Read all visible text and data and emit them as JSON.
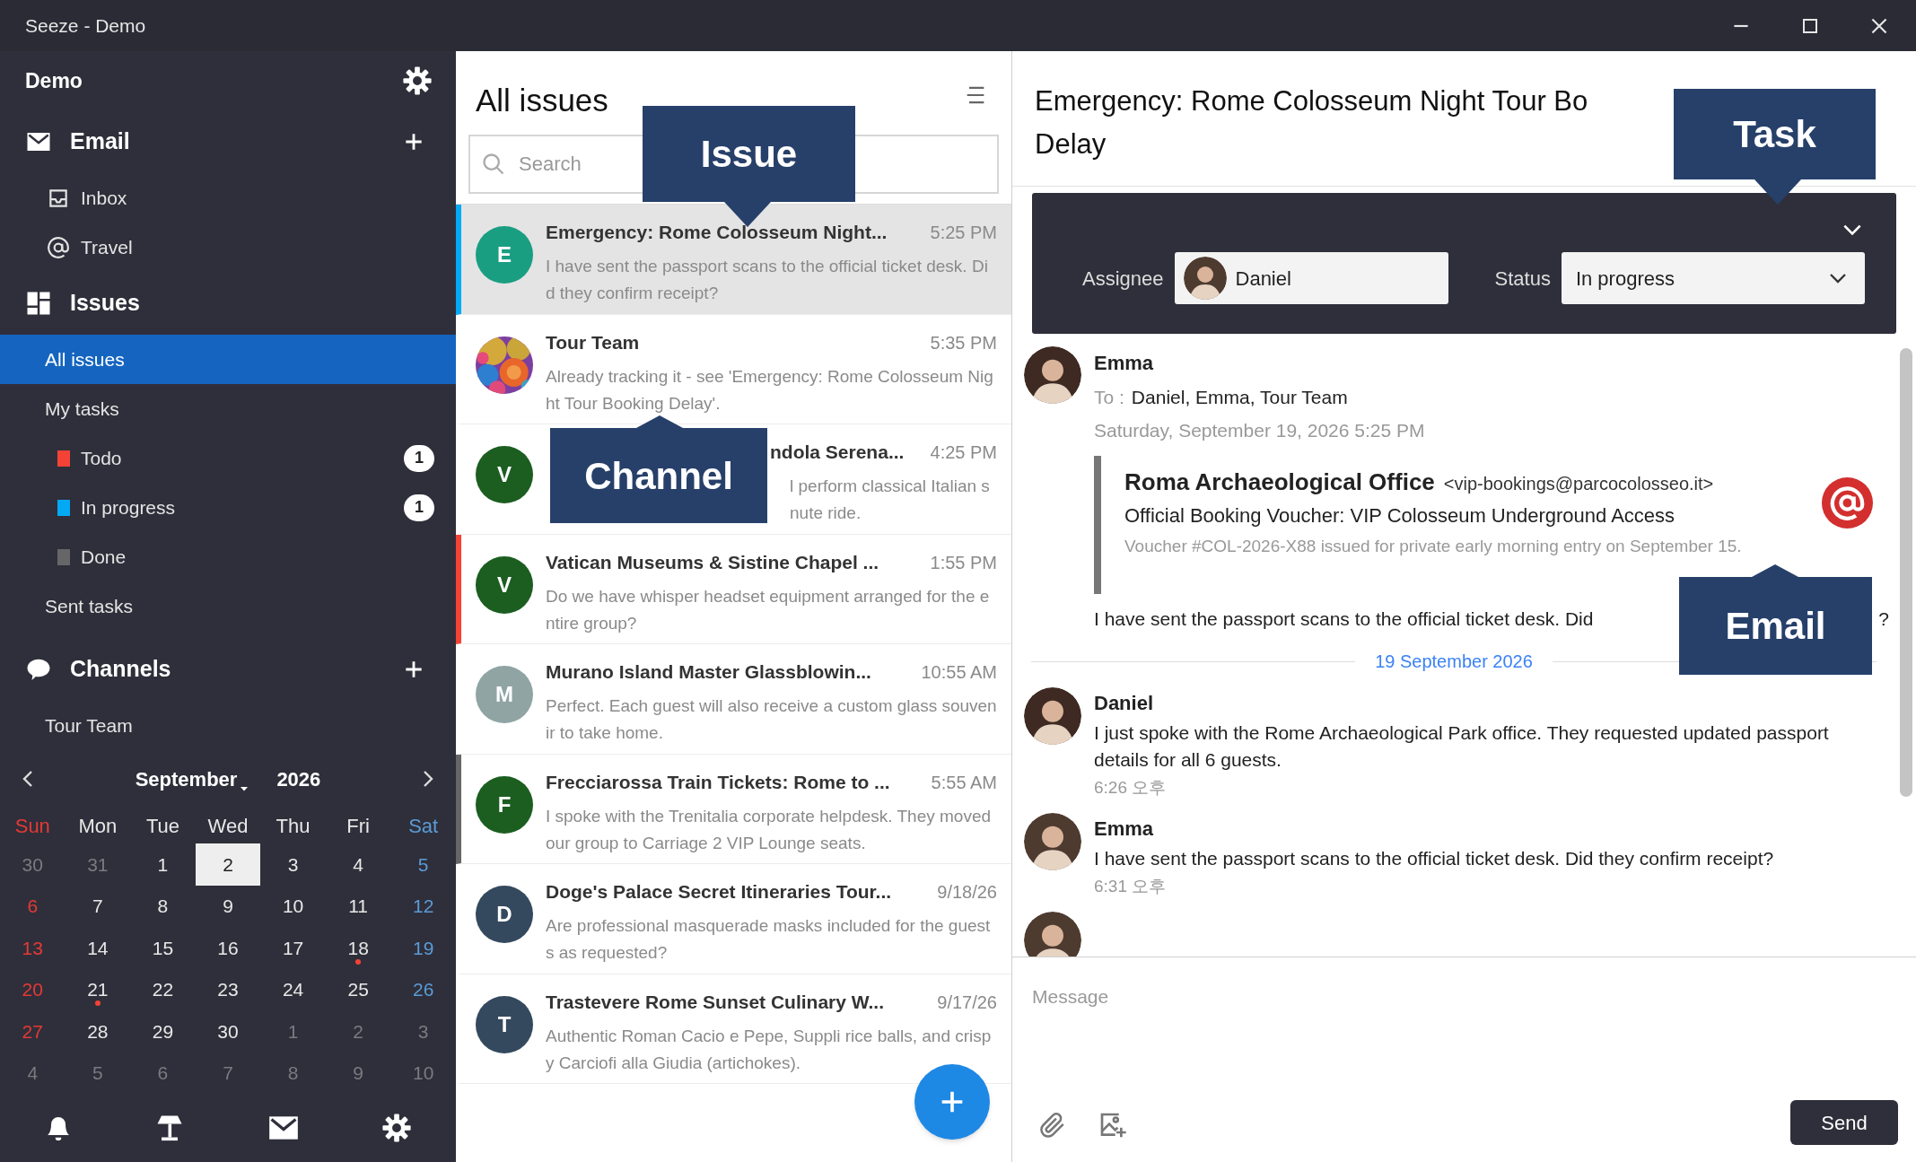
{
  "window": {
    "title": "Seeze - Demo"
  },
  "sidebar": {
    "workspace": "Demo",
    "sections": [
      {
        "kind": "email",
        "label": "Email",
        "add": true,
        "items": [
          {
            "label": "Inbox",
            "selected": false
          },
          {
            "label": "Travel",
            "selected": false
          }
        ]
      },
      {
        "kind": "issues",
        "label": "Issues",
        "items": [
          {
            "label": "All issues",
            "selected": true
          },
          {
            "label": "My tasks",
            "selected": false,
            "children": [
              {
                "label": "Todo",
                "color": "#f44336",
                "count": "1",
                "selected": false
              },
              {
                "label": "In progress",
                "color": "#03a9f4",
                "count": "1",
                "selected": false
              },
              {
                "label": "Done",
                "color": "#666666",
                "selected": false
              }
            ]
          },
          {
            "label": "Sent tasks",
            "selected": false
          }
        ]
      },
      {
        "kind": "channels",
        "label": "Channels",
        "add": true,
        "items": [
          {
            "label": "Tour Team",
            "selected": false
          }
        ]
      }
    ]
  },
  "calendar": {
    "month": "September",
    "year": "2026",
    "weekdays": [
      "Sun",
      "Mon",
      "Tue",
      "Wed",
      "Thu",
      "Fri",
      "Sat"
    ],
    "weeks": [
      [
        {
          "day": "30",
          "outside": true,
          "selected": false,
          "event": false
        },
        {
          "day": "31",
          "outside": true,
          "selected": false,
          "event": false
        },
        {
          "day": "1",
          "outside": false,
          "selected": false,
          "event": false
        },
        {
          "day": "2",
          "outside": false,
          "selected": true,
          "event": false
        },
        {
          "day": "3",
          "outside": false,
          "selected": false,
          "event": false
        },
        {
          "day": "4",
          "outside": false,
          "selected": false,
          "event": false
        },
        {
          "day": "5",
          "outside": false,
          "selected": false,
          "event": false
        }
      ],
      [
        {
          "day": "6",
          "outside": false,
          "selected": false,
          "event": false
        },
        {
          "day": "7",
          "outside": false,
          "selected": false,
          "event": false
        },
        {
          "day": "8",
          "outside": false,
          "selected": false,
          "event": false
        },
        {
          "day": "9",
          "outside": false,
          "selected": false,
          "event": false
        },
        {
          "day": "10",
          "outside": false,
          "selected": false,
          "event": false
        },
        {
          "day": "11",
          "outside": false,
          "selected": false,
          "event": false
        },
        {
          "day": "12",
          "outside": false,
          "selected": false,
          "event": false
        }
      ],
      [
        {
          "day": "13",
          "outside": false,
          "selected": false,
          "event": false
        },
        {
          "day": "14",
          "outside": false,
          "selected": false,
          "event": false
        },
        {
          "day": "15",
          "outside": false,
          "selected": false,
          "event": false
        },
        {
          "day": "16",
          "outside": false,
          "selected": false,
          "event": false
        },
        {
          "day": "17",
          "outside": false,
          "selected": false,
          "event": false
        },
        {
          "day": "18",
          "outside": false,
          "selected": false,
          "event": true
        },
        {
          "day": "19",
          "outside": false,
          "selected": false,
          "event": false
        }
      ],
      [
        {
          "day": "20",
          "outside": false,
          "selected": false,
          "event": false
        },
        {
          "day": "21",
          "outside": false,
          "selected": false,
          "event": true
        },
        {
          "day": "22",
          "outside": false,
          "selected": false,
          "event": false
        },
        {
          "day": "23",
          "outside": false,
          "selected": false,
          "event": false
        },
        {
          "day": "24",
          "outside": false,
          "selected": false,
          "event": false
        },
        {
          "day": "25",
          "outside": false,
          "selected": false,
          "event": false
        },
        {
          "day": "26",
          "outside": false,
          "selected": false,
          "event": false
        }
      ],
      [
        {
          "day": "27",
          "outside": false,
          "selected": false,
          "event": false
        },
        {
          "day": "28",
          "outside": false,
          "selected": false,
          "event": false
        },
        {
          "day": "29",
          "outside": false,
          "selected": false,
          "event": false
        },
        {
          "day": "30",
          "outside": false,
          "selected": false,
          "event": false
        },
        {
          "day": "1",
          "outside": true,
          "selected": false,
          "event": false
        },
        {
          "day": "2",
          "outside": true,
          "selected": false,
          "event": false
        },
        {
          "day": "3",
          "outside": true,
          "selected": false,
          "event": false
        }
      ],
      [
        {
          "day": "4",
          "outside": true,
          "selected": false,
          "event": false
        },
        {
          "day": "5",
          "outside": true,
          "selected": false,
          "event": false
        },
        {
          "day": "6",
          "outside": true,
          "selected": false,
          "event": false
        },
        {
          "day": "7",
          "outside": true,
          "selected": false,
          "event": false
        },
        {
          "day": "8",
          "outside": true,
          "selected": false,
          "event": false
        },
        {
          "day": "9",
          "outside": true,
          "selected": false,
          "event": false
        },
        {
          "day": "10",
          "outside": true,
          "selected": false,
          "event": false
        }
      ]
    ]
  },
  "issue_list": {
    "title": "All issues",
    "search": {
      "placeholder": "Search"
    },
    "items": [
      {
        "kind": "full",
        "title": "Emergency: Rome Colosseum Night...",
        "time": "5:25 PM",
        "preview": "I have sent the passport scans to the official ticket desk. Did they confirm receipt?",
        "avatar": {
          "kind": "letter",
          "letter": "E",
          "color": "#1a9e82"
        },
        "color": "#03a9f4",
        "selected": true
      },
      {
        "kind": "full",
        "title": "Tour Team",
        "time": "5:35 PM",
        "preview": "Already tracking it - see 'Emergency: Rome Colosseum Night Tour Booking Delay'.",
        "selected": false
      },
      {
        "kind": "covered",
        "title": "ndola Serena...",
        "time": "4:25 PM",
        "preview_lines": [
          "l perform classical Italian s",
          "nute ride."
        ],
        "avatar": {
          "kind": "letter",
          "letter": "V",
          "color": "#1b5e20"
        },
        "selected": false
      },
      {
        "kind": "full",
        "title": "Vatican Museums & Sistine Chapel ...",
        "time": "1:55 PM",
        "preview": "Do we have whisper headset equipment arranged for the entire group?",
        "avatar": {
          "kind": "letter",
          "letter": "V",
          "color": "#1b5e20"
        },
        "color": "#f44336",
        "selected": false
      },
      {
        "kind": "full",
        "title": "Murano Island Master Glassblowin...",
        "time": "10:55 AM",
        "preview": "Perfect. Each guest will also receive a custom glass souvenir to take home.",
        "avatar": {
          "kind": "letter",
          "letter": "M",
          "color": "#90a4a4"
        },
        "selected": false
      },
      {
        "kind": "full",
        "title": "Frecciarossa Train Tickets: Rome to ...",
        "time": "5:55 AM",
        "preview": "I spoke with the Trenitalia corporate helpdesk. They moved our group to Carriage 2 VIP Lounge seats.",
        "avatar": {
          "kind": "letter",
          "letter": "F",
          "color": "#1b5e20"
        },
        "color": "#666666",
        "selected": false
      },
      {
        "kind": "full",
        "title": "Doge's Palace Secret Itineraries Tour...",
        "time": "9/18/26",
        "preview": "Are professional masquerade masks included for the guests as requested?",
        "avatar": {
          "kind": "letter",
          "letter": "D",
          "color": "#34495e"
        },
        "selected": false
      },
      {
        "kind": "full",
        "title": "Trastevere Rome Sunset Culinary W...",
        "time": "9/17/26",
        "preview": "Authentic Roman Cacio e Pepe, Suppli rice balls, and crispy Carciofi alla Giudia (artichokes).",
        "avatar": {
          "kind": "letter",
          "letter": "T",
          "color": "#34495e"
        },
        "selected": false
      }
    ]
  },
  "detail": {
    "title_lines": [
      "Emergency: Rome Colosseum Night Tour Bo",
      "Delay"
    ],
    "task": {
      "assignee_label": "Assignee",
      "assignee": "Daniel",
      "status_label": "Status",
      "status": "In progress"
    },
    "thread": [
      {
        "kind": "email",
        "sender": "Emma",
        "to_label": "To :",
        "recipients": "Daniel, Emma, Tour Team",
        "date": "Saturday, September 19, 2026 5:25 PM",
        "quote": {
          "from": "Roma Archaeological Office",
          "address": "<vip-bookings@parcocolosseo.it>",
          "subject": "Official Booking Voucher: VIP Colosseum Underground Access",
          "snippet": "Voucher #COL-2026-X88 issued for private early morning entry on September 15."
        },
        "body": "I have sent the passport scans to the official ticket desk. Did",
        "body_tail": "?"
      },
      {
        "kind": "date_divider",
        "label": "19 September 2026"
      },
      {
        "kind": "chat",
        "sender": "Daniel",
        "text": "I just spoke with the Rome Archaeological Park office. They requested updated passport details for all 6 guests.",
        "time": "6:26 오후"
      },
      {
        "kind": "chat",
        "sender": "Emma",
        "text": "I have sent the passport scans to the official ticket desk. Did they confirm receipt?",
        "time": "6:31 오후"
      },
      {
        "kind": "cut_off"
      }
    ],
    "composer": {
      "placeholder": "Message",
      "send": "Send"
    }
  },
  "callouts": [
    {
      "label": "Issue",
      "kind": "below"
    },
    {
      "label": "Channel",
      "kind": "above"
    },
    {
      "label": "Task",
      "kind": "below"
    },
    {
      "label": "Email",
      "kind": "above"
    }
  ]
}
